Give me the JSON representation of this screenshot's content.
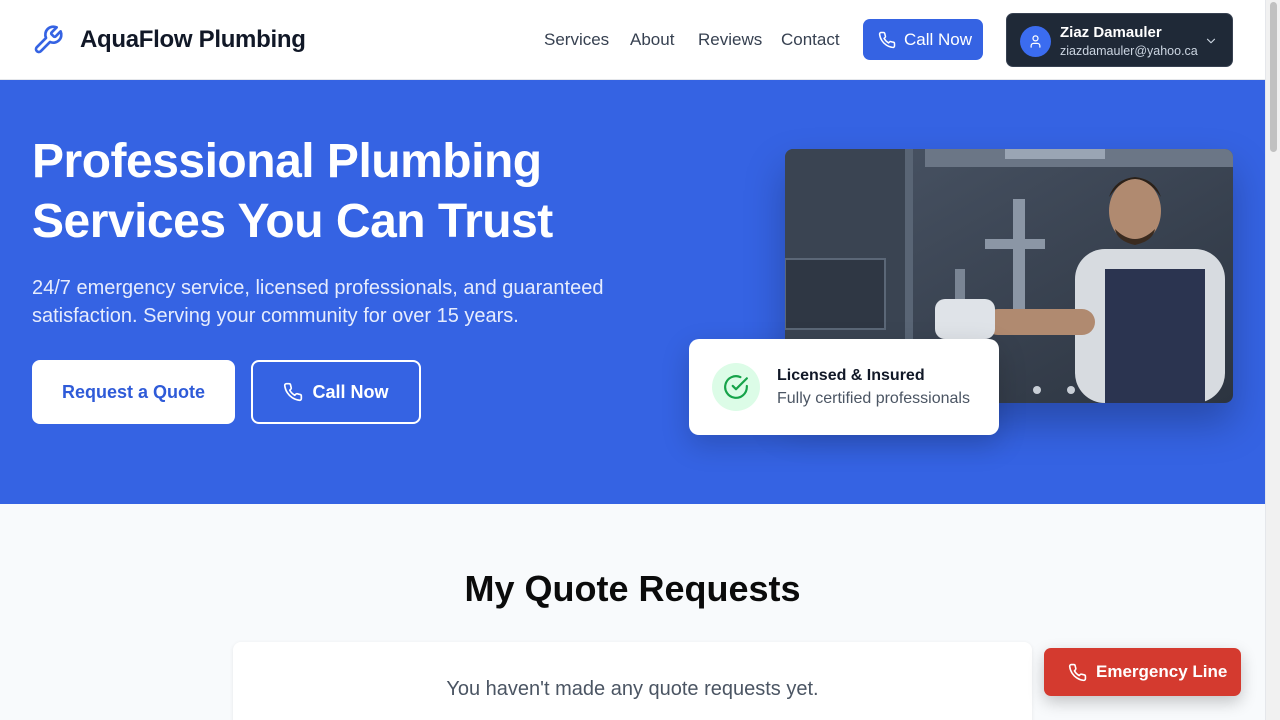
{
  "header": {
    "brand": "AquaFlow Plumbing",
    "logo_icon": "wrench-icon",
    "nav": [
      "Services",
      "About",
      "Reviews",
      "Contact"
    ],
    "call_button": "Call Now",
    "user": {
      "name": "Ziaz Damauler",
      "email": "ziazdamauler@yahoo.ca"
    }
  },
  "hero": {
    "title": "Professional Plumbing Services You Can Trust",
    "subtitle": "24/7 emergency service, licensed professionals, and guaranteed satisfaction. Serving your community for over 15 years.",
    "primary_button": "Request a Quote",
    "secondary_button": "Call Now",
    "badge": {
      "title": "Licensed & Insured",
      "subtitle": "Fully certified professionals"
    }
  },
  "quotes": {
    "title": "My Quote Requests",
    "empty": "You haven't made any quote requests yet."
  },
  "emergency_button": "Emergency Line",
  "colors": {
    "primary": "#3563e3",
    "emergency": "#d43a2f",
    "success": "#16a34a"
  }
}
